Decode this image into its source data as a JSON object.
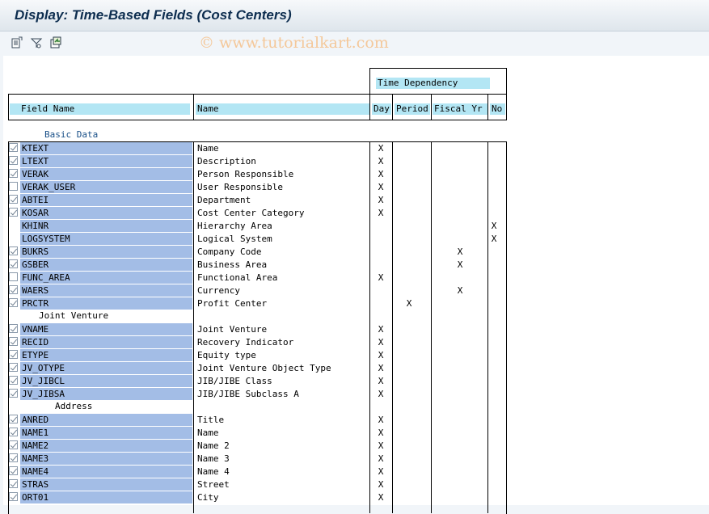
{
  "window": {
    "title": "Display: Time-Based Fields (Cost Centers)"
  },
  "toolbar": {
    "buttons": [
      "other-object-icon",
      "settings-icon",
      "export-icon"
    ]
  },
  "watermark": "© www.tutorialkart.com",
  "table": {
    "group_header": "Time Dependency",
    "headers": {
      "field": "Field Name",
      "name": "Name",
      "day": "Day",
      "period": "Period",
      "fiscal": "Fiscal Yr",
      "no": "No"
    },
    "section_label": "Basic Data",
    "groups": [
      {
        "label": "",
        "rows": [
          {
            "field": "KTEXT",
            "name": "Name",
            "checkbox": true,
            "checked": true,
            "col": "day"
          },
          {
            "field": "LTEXT",
            "name": "Description",
            "checkbox": true,
            "checked": true,
            "col": "day"
          },
          {
            "field": "VERAK",
            "name": "Person Responsible",
            "checkbox": true,
            "checked": true,
            "col": "day"
          },
          {
            "field": "VERAK_USER",
            "name": "User Responsible",
            "checkbox": true,
            "checked": false,
            "col": "day"
          },
          {
            "field": "ABTEI",
            "name": "Department",
            "checkbox": true,
            "checked": true,
            "col": "day"
          },
          {
            "field": "KOSAR",
            "name": "Cost Center Category",
            "checkbox": true,
            "checked": true,
            "col": "day"
          },
          {
            "field": "KHINR",
            "name": "Hierarchy Area",
            "checkbox": false,
            "checked": false,
            "col": "no"
          },
          {
            "field": "LOGSYSTEM",
            "name": "Logical System",
            "checkbox": false,
            "checked": false,
            "col": "no"
          },
          {
            "field": "BUKRS",
            "name": "Company Code",
            "checkbox": true,
            "checked": true,
            "col": "fiscal"
          },
          {
            "field": "GSBER",
            "name": "Business Area",
            "checkbox": true,
            "checked": true,
            "col": "fiscal"
          },
          {
            "field": "FUNC_AREA",
            "name": "Functional Area",
            "checkbox": true,
            "checked": false,
            "col": "day"
          },
          {
            "field": "WAERS",
            "name": "Currency",
            "checkbox": true,
            "checked": true,
            "col": "fiscal"
          },
          {
            "field": "PRCTR",
            "name": "Profit Center",
            "checkbox": true,
            "checked": true,
            "col": "period"
          }
        ]
      },
      {
        "label": "Joint Venture",
        "rows": [
          {
            "field": "VNAME",
            "name": "Joint Venture",
            "checkbox": true,
            "checked": true,
            "col": "day"
          },
          {
            "field": "RECID",
            "name": "Recovery Indicator",
            "checkbox": true,
            "checked": true,
            "col": "day"
          },
          {
            "field": "ETYPE",
            "name": "Equity type",
            "checkbox": true,
            "checked": true,
            "col": "day"
          },
          {
            "field": "JV_OTYPE",
            "name": "Joint Venture Object Type",
            "checkbox": true,
            "checked": true,
            "col": "day"
          },
          {
            "field": "JV_JIBCL",
            "name": "JIB/JIBE Class",
            "checkbox": true,
            "checked": true,
            "col": "day"
          },
          {
            "field": "JV_JIBSA",
            "name": "JIB/JIBE Subclass A",
            "checkbox": true,
            "checked": true,
            "col": "day"
          }
        ]
      },
      {
        "label": "Address",
        "rows": [
          {
            "field": "ANRED",
            "name": "Title",
            "checkbox": true,
            "checked": true,
            "col": "day"
          },
          {
            "field": "NAME1",
            "name": "Name",
            "checkbox": true,
            "checked": true,
            "col": "day"
          },
          {
            "field": "NAME2",
            "name": "Name 2",
            "checkbox": true,
            "checked": true,
            "col": "day"
          },
          {
            "field": "NAME3",
            "name": "Name 3",
            "checkbox": true,
            "checked": true,
            "col": "day"
          },
          {
            "field": "NAME4",
            "name": "Name 4",
            "checkbox": true,
            "checked": true,
            "col": "day"
          },
          {
            "field": "STRAS",
            "name": "Street",
            "checkbox": true,
            "checked": true,
            "col": "day"
          },
          {
            "field": "ORT01",
            "name": "City",
            "checkbox": true,
            "checked": true,
            "col": "day"
          }
        ]
      }
    ],
    "mark": "X"
  }
}
